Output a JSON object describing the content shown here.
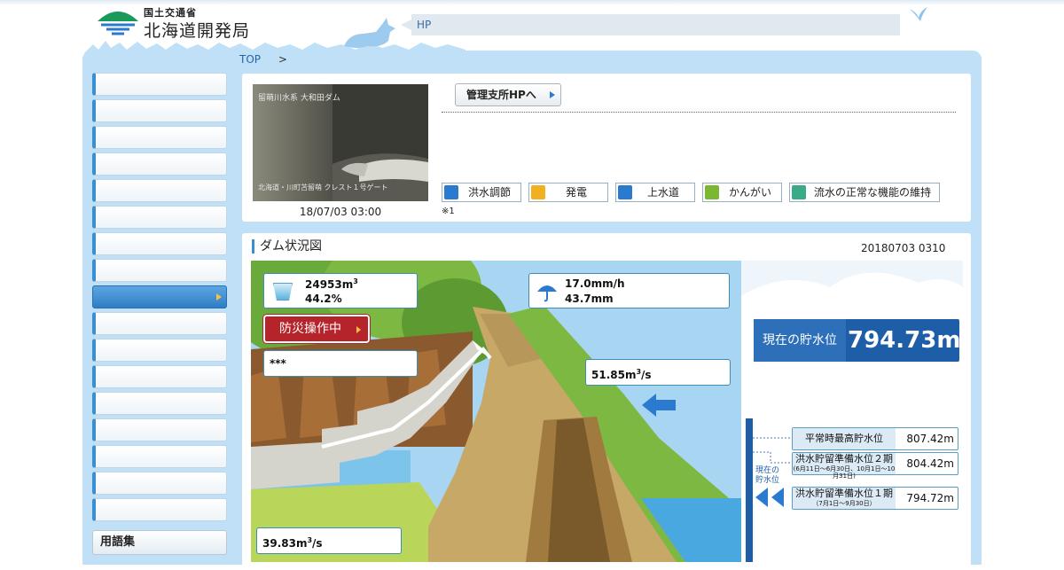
{
  "header": {
    "ministry": "国土交通省",
    "bureau": "北海道開発局",
    "hp_text": "HP"
  },
  "breadcrumb": {
    "top": "TOP",
    "separator": ">"
  },
  "sidebar": {
    "item_count": 17,
    "active_index": 8,
    "glossary": "用語集"
  },
  "camera": {
    "label_top": "留萌川水系 大和田ダム",
    "label_bottom": "北海道・川町苫留萌 クレスト１号ゲート",
    "timestamp": "18/07/03 03:00"
  },
  "office_button": "管理支所HPへ",
  "purposes": [
    {
      "label": "洪水調節",
      "icon": "arrow-down-icon",
      "color": "#2a7bd0"
    },
    {
      "label": "発電",
      "icon": "lightning-icon",
      "color": "#f0b020"
    },
    {
      "label": "上水道",
      "icon": "faucet-icon",
      "color": "#2a7bd0"
    },
    {
      "label": "かんがい",
      "icon": "sprout-icon",
      "color": "#7ab830"
    },
    {
      "label": "流水の正常な機能の維持",
      "icon": "wave-icon",
      "color": "#3aaa88"
    }
  ],
  "note": "※1",
  "dam": {
    "title": "ダム状況図",
    "timestamp": "20180703 0310",
    "storage_volume": "24953m",
    "storage_unit_sup": "3",
    "storage_rate": "44.2%",
    "rain_intensity": "17.0mm/h",
    "rain_total": "43.7mm",
    "bousai_button": "防災操作中",
    "status_text": "***",
    "inflow": "51.85m",
    "inflow_sup": "3",
    "inflow_unit": "/s",
    "outflow": "39.83m",
    "outflow_sup": "3",
    "outflow_unit": "/s",
    "current_level_label": "現在の貯水位",
    "current_level_value": "794.73m",
    "current_marker_label": "現在の\n貯水位",
    "levels": [
      {
        "name": "平常時最高貯水位",
        "sub": "",
        "value": "807.42m"
      },
      {
        "name": "洪水貯留準備水位２期",
        "sub": "(6月11日〜6月30日、10月1日〜10月31日)",
        "value": "804.42m"
      },
      {
        "name": "洪水貯留準備水位１期",
        "sub": "（7月1日〜9月30日）",
        "value": "794.72m"
      }
    ]
  }
}
